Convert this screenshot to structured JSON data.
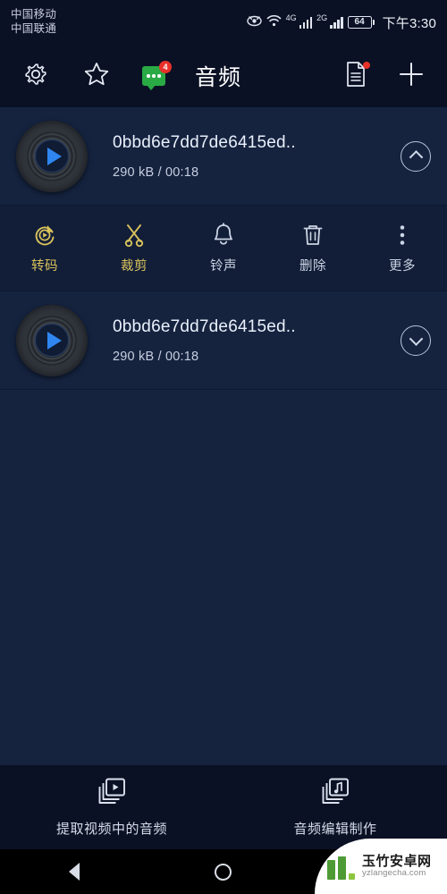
{
  "status_bar": {
    "carrier_primary": "中国移动",
    "carrier_secondary": "中国联通",
    "eye_icon": "eye-comfort-icon",
    "wifi_icon": "wifi-icon",
    "sim1_network": "4G",
    "sim1_icon": "signal-bars-icon",
    "sim2_network": "2G",
    "sim2_icon": "signal-bars-icon",
    "battery_level": "64",
    "battery_icon": "battery-icon",
    "time": "下午3:30"
  },
  "toolbar": {
    "settings_icon": "gear-icon",
    "favorite_icon": "star-icon",
    "feedback_icon": "chat-bubble-icon",
    "feedback_badge": "4",
    "title": "音频",
    "document_icon": "document-icon",
    "add_icon": "plus-icon"
  },
  "list": {
    "items": [
      {
        "thumbnail_icon": "vinyl-record-icon",
        "play_icon": "play-icon",
        "title": "0bbd6e7dd7de6415ed..",
        "meta": "290 kB / 00:18",
        "expand_icon": "chevron-up-icon",
        "expanded": true
      },
      {
        "thumbnail_icon": "vinyl-record-icon",
        "play_icon": "play-icon",
        "title": "0bbd6e7dd7de6415ed..",
        "meta": "290 kB / 00:18",
        "expand_icon": "chevron-down-icon",
        "expanded": false
      }
    ]
  },
  "action_bar": {
    "actions": [
      {
        "label": "转码",
        "icon": "transcode-icon",
        "color": "#d9c25c"
      },
      {
        "label": "裁剪",
        "icon": "scissors-icon",
        "color": "#d9c25c"
      },
      {
        "label": "铃声",
        "icon": "bell-icon",
        "color": "#cbd4e4"
      },
      {
        "label": "删除",
        "icon": "trash-icon",
        "color": "#cbd4e4"
      },
      {
        "label": "更多",
        "icon": "more-vertical-icon",
        "color": "#cbd4e4"
      }
    ]
  },
  "bottom_bar": {
    "items": [
      {
        "label": "提取视频中的音频",
        "icon": "video-to-audio-icon"
      },
      {
        "label": "音频编辑制作",
        "icon": "audio-edit-icon"
      }
    ]
  },
  "nav_bar": {
    "back_icon": "back-triangle-icon",
    "home_icon": "home-circle-icon",
    "recents_icon": "recents-square-icon"
  },
  "watermark": {
    "name_cn": "玉竹安卓网",
    "name_en": "yzlangecha.com"
  },
  "colors": {
    "background": "#15233f",
    "bar_background": "#0a1124",
    "accent_gold": "#d9c25c",
    "accent_blue": "#2f86f0",
    "badge_red": "#e8312a",
    "chat_green": "#2aaa45"
  }
}
